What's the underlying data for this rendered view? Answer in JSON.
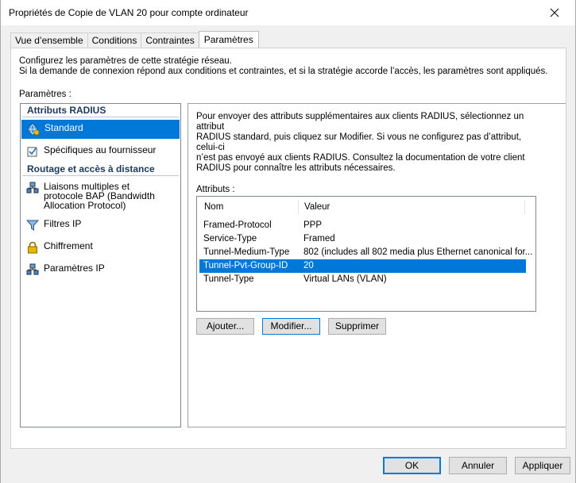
{
  "window": {
    "title": "Propriétés de Copie de VLAN 20 pour compte ordinateur",
    "close_glyph": "✕"
  },
  "tabs": [
    {
      "label": "Vue d’ensemble"
    },
    {
      "label": "Conditions"
    },
    {
      "label": "Contraintes"
    },
    {
      "label": "Paramètres"
    }
  ],
  "intro": {
    "line1": "Configurez les paramètres de cette stratégie réseau.",
    "line2": "Si la demande de connexion répond aux conditions et contraintes, et si la stratégie accorde l’accès, les paramètres sont appliqués."
  },
  "params_label": "Paramètres :",
  "left_list": {
    "group1": "Attributs RADIUS",
    "items1": [
      {
        "label": "Standard",
        "icon": "globe-settings-icon"
      },
      {
        "label": "Spécifiques au fournisseur",
        "icon": "checkbox-doc-icon"
      }
    ],
    "group2": "Routage et accès à distance",
    "items2": [
      {
        "label": "Liaisons multiples et protocole BAP (Bandwidth Allocation Protocol)",
        "icon": "network-icon"
      },
      {
        "label": "Filtres IP",
        "icon": "filter-icon"
      },
      {
        "label": "Chiffrement",
        "icon": "lock-icon"
      },
      {
        "label": "Paramètres IP",
        "icon": "network-icon"
      }
    ]
  },
  "right": {
    "desc_line1": "Pour envoyer des attributs supplémentaires aux clients RADIUS, sélectionnez un attribut",
    "desc_line2": "RADIUS standard, puis cliquez sur Modifier. Si vous ne configurez pas d’attribut, celui-ci",
    "desc_line3": "n’est pas envoyé aux clients RADIUS. Consultez la documentation de votre client",
    "desc_line4": "RADIUS pour connaître les attributs nécessaires.",
    "attrs_label": "Attributs :",
    "columns": [
      "Nom",
      "Valeur"
    ],
    "rows": [
      {
        "name": "Framed-Protocol",
        "value": "PPP"
      },
      {
        "name": "Service-Type",
        "value": "Framed"
      },
      {
        "name": "Tunnel-Medium-Type",
        "value": "802 (includes all 802 media plus Ethernet canonical for..."
      },
      {
        "name": "Tunnel-Pvt-Group-ID",
        "value": "20"
      },
      {
        "name": "Tunnel-Type",
        "value": "Virtual LANs (VLAN)"
      }
    ],
    "buttons": {
      "add": "Ajouter...",
      "edit": "Modifier...",
      "delete": "Supprimer"
    }
  },
  "footer": {
    "ok": "OK",
    "cancel": "Annuler",
    "apply": "Appliquer"
  },
  "colors": {
    "selection": "#0078d7",
    "group_header": "#1e395b"
  }
}
